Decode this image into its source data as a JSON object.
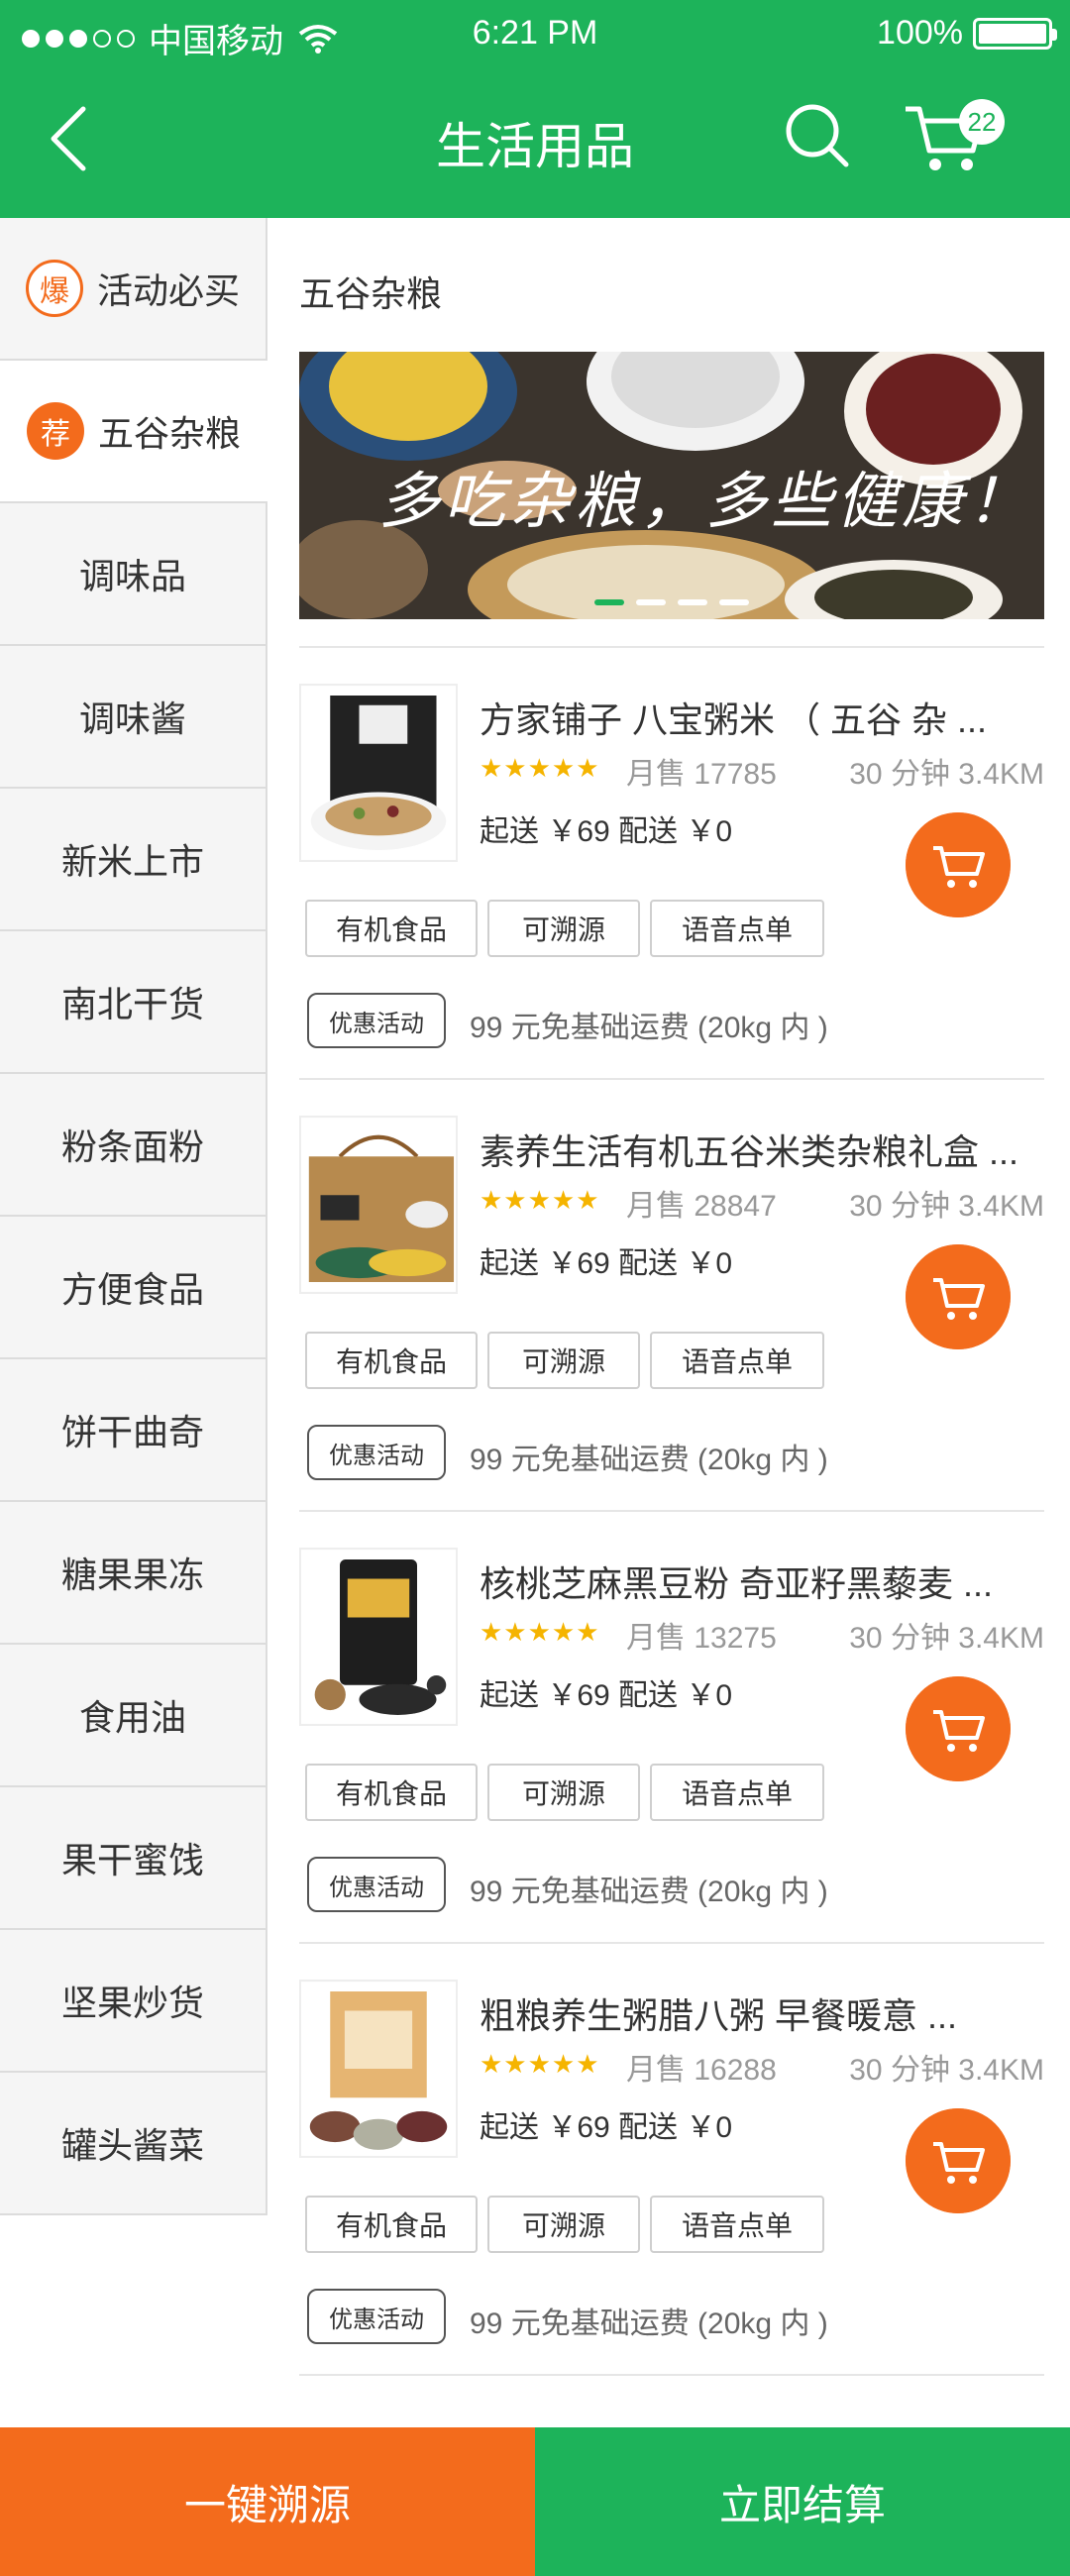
{
  "status_bar": {
    "carrier": "中国移动",
    "time": "6:21 PM",
    "battery": "100%"
  },
  "header": {
    "title": "生活用品",
    "cart_count": "22"
  },
  "sidebar": {
    "items": [
      {
        "label": "活动必买",
        "badge": "爆"
      },
      {
        "label": "五谷杂粮",
        "badge": "荐"
      },
      {
        "label": "调味品"
      },
      {
        "label": "调味酱"
      },
      {
        "label": "新米上市"
      },
      {
        "label": "南北干货"
      },
      {
        "label": "粉条面粉"
      },
      {
        "label": "方便食品"
      },
      {
        "label": "饼干曲奇"
      },
      {
        "label": "糖果果冻"
      },
      {
        "label": "食用油"
      },
      {
        "label": "果干蜜饯"
      },
      {
        "label": "坚果炒货"
      },
      {
        "label": "罐头酱菜"
      }
    ]
  },
  "main": {
    "section_title": "五谷杂粮",
    "banner_text": "多吃杂粮，多些健康！"
  },
  "products": [
    {
      "name": "方家铺子 八宝粥米 （ 五谷 杂 ...",
      "stars": "★★★★★",
      "sales": "月售 17785",
      "distance": "30 分钟  3.4KM",
      "delivery": "起送 ￥69   配送 ￥0",
      "tags": [
        "有机食品",
        "可溯源",
        "语音点单"
      ],
      "promo_label": "优惠活动",
      "promo_text": "99 元免基础运费 (20kg 内 )"
    },
    {
      "name": "素养生活有机五谷米类杂粮礼盒 ...",
      "stars": "★★★★★",
      "sales": "月售 28847",
      "distance": "30 分钟  3.4KM",
      "delivery": "起送 ￥69   配送 ￥0",
      "tags": [
        "有机食品",
        "可溯源",
        "语音点单"
      ],
      "promo_label": "优惠活动",
      "promo_text": "99 元免基础运费 (20kg 内 )"
    },
    {
      "name": "核桃芝麻黑豆粉 奇亚籽黑藜麦 ...",
      "stars": "★★★★★",
      "sales": "月售 13275",
      "distance": "30 分钟  3.4KM",
      "delivery": "起送 ￥69   配送 ￥0",
      "tags": [
        "有机食品",
        "可溯源",
        "语音点单"
      ],
      "promo_label": "优惠活动",
      "promo_text": "99 元免基础运费 (20kg 内 )"
    },
    {
      "name": "粗粮养生粥腊八粥 早餐暖意 ...",
      "stars": "★★★★★",
      "sales": "月售 16288",
      "distance": "30 分钟  3.4KM",
      "delivery": "起送 ￥69   配送 ￥0",
      "tags": [
        "有机食品",
        "可溯源",
        "语音点单"
      ],
      "promo_label": "优惠活动",
      "promo_text": "99 元免基础运费 (20kg 内 )"
    }
  ],
  "bottom_bar": {
    "trace_label": "一键溯源",
    "checkout_label": "立即结算"
  },
  "colors": {
    "brand_green": "#1db35a",
    "accent_orange": "#f36b1c",
    "star_yellow": "#f5b400"
  },
  "icons": [
    "back-icon",
    "search-icon",
    "cart-icon",
    "wifi-icon",
    "battery-icon"
  ]
}
